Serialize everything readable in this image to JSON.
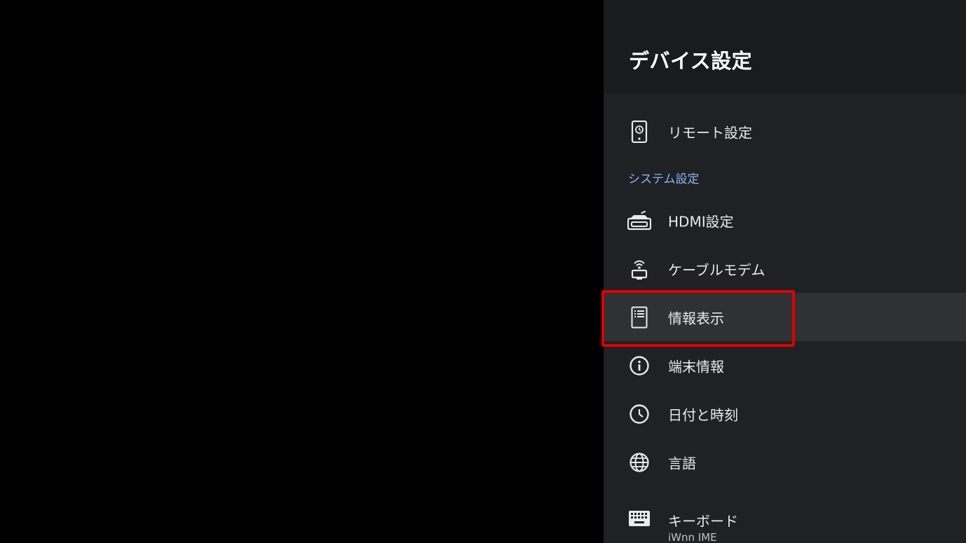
{
  "panel": {
    "title": "デバイス設定"
  },
  "menu": {
    "remote": {
      "label": "リモート設定",
      "icon": "remote-icon"
    },
    "section_system": "システム設定",
    "hdmi": {
      "label": "HDMI設定",
      "icon": "hdmi-icon"
    },
    "cable_modem": {
      "label": "ケーブルモデム",
      "icon": "cable-modem-icon"
    },
    "info_display": {
      "label": "情報表示",
      "icon": "list-document-icon"
    },
    "device_info": {
      "label": "端末情報",
      "icon": "info-icon"
    },
    "date_time": {
      "label": "日付と時刻",
      "icon": "clock-icon"
    },
    "language": {
      "label": "言語",
      "icon": "globe-icon"
    },
    "keyboard": {
      "label": "キーボード",
      "sublabel": "iWnn IME",
      "icon": "keyboard-icon"
    }
  },
  "colors": {
    "panel_bg": "#202124",
    "header_bg": "#1a1b1d",
    "focused_bg": "#303134",
    "section_accent": "#8ab4f8",
    "highlight_red": "#e00000"
  }
}
